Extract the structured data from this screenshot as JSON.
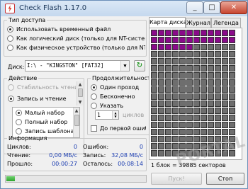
{
  "window": {
    "title": "Check Flash 1.17.0"
  },
  "access": {
    "legend": "Тип доступа",
    "options": [
      {
        "label": "Использовать временный файл",
        "selected": true
      },
      {
        "label": "Как логический диск (только для NT-систем)",
        "selected": false
      },
      {
        "label": "Как физическое устройство (только для NT-сис",
        "selected": false
      }
    ]
  },
  "disk": {
    "label": "Диск:",
    "value": "I:\\ - \"KINGSTON\" [FAT32]",
    "refresh_icon": "refresh-icon"
  },
  "action": {
    "legend": "Действие",
    "options": [
      {
        "label": "Стабильность чтени",
        "selected": false,
        "disabled": true
      },
      {
        "label": "Запись и чтение",
        "selected": true,
        "disabled": false
      }
    ],
    "sub_options": [
      {
        "label": "Малый набор",
        "selected": true
      },
      {
        "label": "Полный набор",
        "selected": false
      },
      {
        "label": "Запись шаблона",
        "selected": false
      }
    ]
  },
  "duration": {
    "legend": "Продолжительность",
    "options": [
      {
        "label": "Один проход",
        "selected": true
      },
      {
        "label": "Бесконечно",
        "selected": false
      },
      {
        "label": "Указать",
        "selected": false
      }
    ],
    "cycles_value": "1",
    "cycles_unit": "циклов",
    "until_error_label": "До первой ошибки"
  },
  "info": {
    "legend": "Информация",
    "rows": [
      {
        "k1": "Циклов:",
        "v1": "0",
        "k2": "Ошибок:",
        "v2": "0"
      },
      {
        "k1": "Чтение:",
        "v1": "0,00 МБ/с",
        "k2": "Запись:",
        "v2": "32,08 МБ/с"
      },
      {
        "k1": "Прошло:",
        "v1": "00:00:27",
        "k2": "Осталось:",
        "v2": "00:08:14"
      }
    ]
  },
  "progress": {
    "fraction": 0.06
  },
  "tabs": [
    {
      "label": "Карта диска",
      "active": true
    },
    {
      "label": "Журнал",
      "active": false
    },
    {
      "label": "Легенда",
      "active": false
    }
  ],
  "map": {
    "columns": 12,
    "rows": 18,
    "written_cells": 30,
    "written_color": "#8a0a8a",
    "pending_color": "#6e6e6e"
  },
  "status": "1 блок = 39885 секторов",
  "buttons": {
    "start": "Пуск!",
    "stop": "Стоп"
  },
  "watermark": "PORTAL"
}
